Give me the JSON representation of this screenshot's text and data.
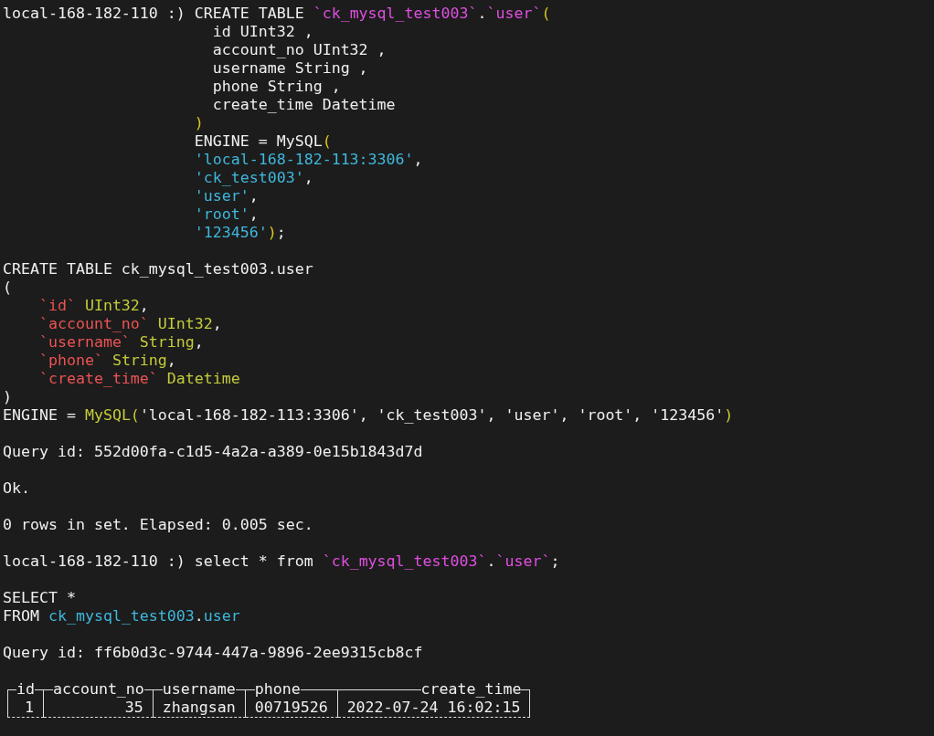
{
  "terminal": {
    "lines": [
      {
        "kind": "code",
        "segments": [
          {
            "kind": "plain",
            "text": "local-168-182-110 :) CREATE TABLE "
          },
          {
            "kind": "ident",
            "text": "`ck_mysql_test003`"
          },
          {
            "kind": "plain",
            "text": "."
          },
          {
            "kind": "ident",
            "text": "`user`"
          },
          {
            "kind": "paren",
            "text": "("
          }
        ]
      },
      {
        "kind": "deep",
        "segments": [
          {
            "kind": "plain",
            "text": "id UInt32 ,"
          }
        ]
      },
      {
        "kind": "deep",
        "segments": [
          {
            "kind": "plain",
            "text": "account_no UInt32 ,"
          }
        ]
      },
      {
        "kind": "deep",
        "segments": [
          {
            "kind": "plain",
            "text": "username String ,"
          }
        ]
      },
      {
        "kind": "deep",
        "segments": [
          {
            "kind": "plain",
            "text": "phone String ,"
          }
        ]
      },
      {
        "kind": "deep",
        "segments": [
          {
            "kind": "plain",
            "text": "create_time Datetime"
          }
        ]
      },
      {
        "kind": "inner",
        "segments": [
          {
            "kind": "paren",
            "text": ")"
          }
        ]
      },
      {
        "kind": "inner",
        "segments": [
          {
            "kind": "plain",
            "text": "ENGINE = MySQL"
          },
          {
            "kind": "paren",
            "text": "("
          }
        ]
      },
      {
        "kind": "inner",
        "segments": [
          {
            "kind": "str",
            "text": "'local-168-182-113:3306'"
          },
          {
            "kind": "plain",
            "text": ","
          }
        ]
      },
      {
        "kind": "inner",
        "segments": [
          {
            "kind": "str",
            "text": "'ck_test003'"
          },
          {
            "kind": "plain",
            "text": ","
          }
        ]
      },
      {
        "kind": "inner",
        "segments": [
          {
            "kind": "str",
            "text": "'user'"
          },
          {
            "kind": "plain",
            "text": ","
          }
        ]
      },
      {
        "kind": "inner",
        "segments": [
          {
            "kind": "str",
            "text": "'root'"
          },
          {
            "kind": "plain",
            "text": ","
          }
        ]
      },
      {
        "kind": "inner",
        "segments": [
          {
            "kind": "str",
            "text": "'123456'"
          },
          {
            "kind": "paren",
            "text": ")"
          },
          {
            "kind": "plain",
            "text": ";"
          }
        ]
      },
      {
        "kind": "blank"
      },
      {
        "kind": "code",
        "segments": [
          {
            "kind": "plain",
            "text": "CREATE TABLE ck_mysql_test003.user"
          }
        ]
      },
      {
        "kind": "code",
        "segments": [
          {
            "kind": "plain",
            "text": "("
          }
        ]
      },
      {
        "kind": "field",
        "segments": [
          {
            "kind": "col",
            "text": "`id` "
          },
          {
            "kind": "type",
            "text": "UInt32"
          },
          {
            "kind": "plain",
            "text": ","
          }
        ]
      },
      {
        "kind": "field",
        "segments": [
          {
            "kind": "col",
            "text": "`account_no` "
          },
          {
            "kind": "type",
            "text": "UInt32"
          },
          {
            "kind": "plain",
            "text": ","
          }
        ]
      },
      {
        "kind": "field",
        "segments": [
          {
            "kind": "col",
            "text": "`username` "
          },
          {
            "kind": "type",
            "text": "String"
          },
          {
            "kind": "plain",
            "text": ","
          }
        ]
      },
      {
        "kind": "field",
        "segments": [
          {
            "kind": "col",
            "text": "`phone` "
          },
          {
            "kind": "type",
            "text": "String"
          },
          {
            "kind": "plain",
            "text": ","
          }
        ]
      },
      {
        "kind": "field",
        "segments": [
          {
            "kind": "col",
            "text": "`create_time` "
          },
          {
            "kind": "type",
            "text": "Datetime"
          }
        ]
      },
      {
        "kind": "code",
        "segments": [
          {
            "kind": "plain",
            "text": ")"
          }
        ]
      },
      {
        "kind": "code",
        "segments": [
          {
            "kind": "plain",
            "text": "ENGINE = "
          },
          {
            "kind": "type",
            "text": "MySQL("
          },
          {
            "kind": "plain",
            "text": "'local-168-182-113:3306', 'ck_test003', 'user', 'root', '123456'"
          },
          {
            "kind": "type",
            "text": ")"
          }
        ]
      },
      {
        "kind": "blank"
      },
      {
        "kind": "code",
        "segments": [
          {
            "kind": "plain",
            "text": "Query id: 552d00fa-c1d5-4a2a-a389-0e15b1843d7d"
          }
        ]
      },
      {
        "kind": "blank"
      },
      {
        "kind": "code",
        "segments": [
          {
            "kind": "plain",
            "text": "Ok."
          }
        ]
      },
      {
        "kind": "blank"
      },
      {
        "kind": "code",
        "segments": [
          {
            "kind": "plain",
            "text": "0 rows in set. Elapsed: 0.005 sec."
          }
        ]
      },
      {
        "kind": "blank"
      },
      {
        "kind": "code",
        "segments": [
          {
            "kind": "plain",
            "text": "local-168-182-110 :) select * from "
          },
          {
            "kind": "ident",
            "text": "`ck_mysql_test003`"
          },
          {
            "kind": "plain",
            "text": "."
          },
          {
            "kind": "ident",
            "text": "`user`"
          },
          {
            "kind": "plain",
            "text": ";"
          }
        ]
      },
      {
        "kind": "blank"
      },
      {
        "kind": "code",
        "segments": [
          {
            "kind": "plain",
            "text": "SELECT *"
          }
        ]
      },
      {
        "kind": "code",
        "segments": [
          {
            "kind": "plain",
            "text": "FROM "
          },
          {
            "kind": "str",
            "text": "ck_mysql_test003"
          },
          {
            "kind": "plain",
            "text": "."
          },
          {
            "kind": "str",
            "text": "user"
          }
        ]
      },
      {
        "kind": "blank"
      },
      {
        "kind": "code",
        "segments": [
          {
            "kind": "plain",
            "text": "Query id: ff6b0d3c-9744-447a-9896-2ee9315cb8cf"
          }
        ]
      },
      {
        "kind": "blank"
      }
    ],
    "result_table": {
      "columns": [
        {
          "label": "id",
          "kind": "numeric"
        },
        {
          "label": "account_no",
          "kind": "numeric"
        },
        {
          "label": "username",
          "kind": "text"
        },
        {
          "label": "phone",
          "kind": "text"
        },
        {
          "label": "create_time",
          "kind": "numeric"
        }
      ],
      "rows": [
        [
          "1",
          "35",
          "zhangsan",
          "00719526",
          "2022-07-24 16:02:15"
        ]
      ]
    }
  }
}
